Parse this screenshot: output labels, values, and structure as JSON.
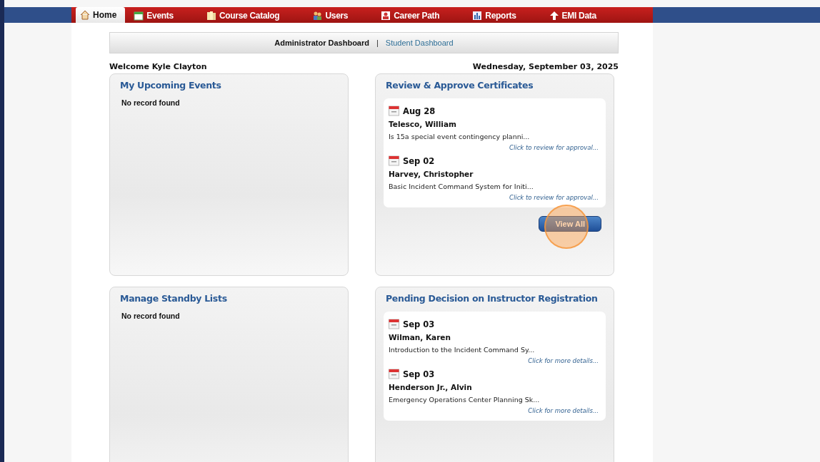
{
  "nav": {
    "tabs": [
      {
        "label": "Home",
        "selected": true
      },
      {
        "label": "Events",
        "selected": false
      },
      {
        "label": "Course Catalog",
        "selected": false
      },
      {
        "label": "Users",
        "selected": false
      },
      {
        "label": "Career Path",
        "selected": false
      },
      {
        "label": "Reports",
        "selected": false
      },
      {
        "label": "EMI Data",
        "selected": false
      }
    ]
  },
  "dashboards": [
    {
      "label": "Administrator Dashboard",
      "selected": true
    },
    {
      "label": "Student Dashboard",
      "selected": false
    }
  ],
  "separator": "|",
  "welcome": "Welcome Kyle Clayton",
  "date": "Wednesday, September 03, 2025",
  "panels": [
    {
      "title": "My Upcoming Events",
      "empty_text": "No record found"
    },
    {
      "title": "Review & Approve Certificates",
      "items": [
        {
          "date": "Aug 28",
          "name": "Telesco, William",
          "course": "Is 15a special event contingency planni...",
          "link": "Click to review for approval..."
        },
        {
          "date": "Sep 02",
          "name": "Harvey, Christopher",
          "course": "Basic Incident Command System for Initi...",
          "link": "Click to review for approval..."
        }
      ],
      "button": {
        "label": "View All",
        "highlighted": true
      }
    },
    {
      "title": "Manage Standby Lists",
      "empty_text": "No record found"
    },
    {
      "title": "Pending Decision on Instructor Registration",
      "items": [
        {
          "date": "Sep 03",
          "name": "Wilman, Karen",
          "course": "Introduction to the Incident Command Sy...",
          "link": "Click for more details..."
        },
        {
          "date": "Sep 03",
          "name": "Henderson Jr., Alvin",
          "course": "Emergency Operations Center Planning Sk...",
          "link": "Click for more details..."
        }
      ]
    }
  ]
}
